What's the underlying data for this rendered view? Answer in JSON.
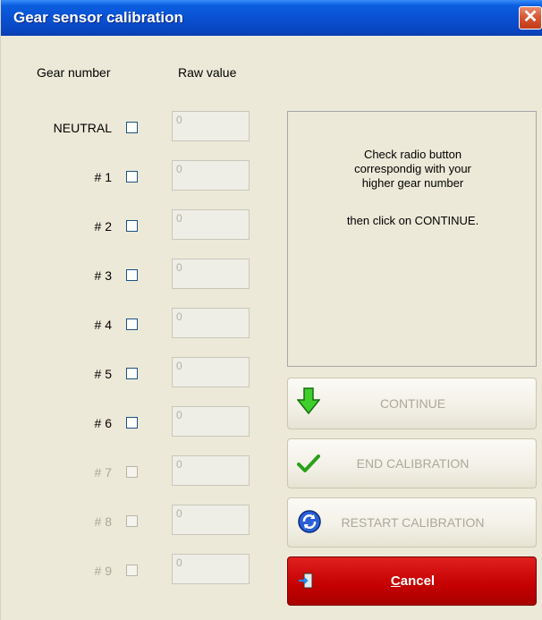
{
  "window": {
    "title": "Gear sensor calibration"
  },
  "headers": {
    "gear_number": "Gear number",
    "raw_value": "Raw value"
  },
  "rows": [
    {
      "label": "NEUTRAL",
      "value": "0",
      "enabled": true
    },
    {
      "label": "# 1",
      "value": "0",
      "enabled": true
    },
    {
      "label": "# 2",
      "value": "0",
      "enabled": true
    },
    {
      "label": "# 3",
      "value": "0",
      "enabled": true
    },
    {
      "label": "# 4",
      "value": "0",
      "enabled": true
    },
    {
      "label": "# 5",
      "value": "0",
      "enabled": true
    },
    {
      "label": "# 6",
      "value": "0",
      "enabled": true
    },
    {
      "label": "# 7",
      "value": "0",
      "enabled": false
    },
    {
      "label": "# 8",
      "value": "0",
      "enabled": false
    },
    {
      "label": "# 9",
      "value": "0",
      "enabled": false
    }
  ],
  "info": {
    "line1": "Check radio button",
    "line2": "correspondig with your",
    "line3": "higher gear number",
    "line4": "then click on CONTINUE."
  },
  "buttons": {
    "continue": {
      "label": "CONTINUE",
      "icon": "green-down-arrow-icon"
    },
    "end": {
      "label": "END CALIBRATION",
      "icon": "green-check-icon"
    },
    "restart": {
      "label": "RESTART CALIBRATION",
      "icon": "refresh-icon"
    },
    "cancel": {
      "label": "Cancel",
      "icon": "exit-door-icon"
    }
  },
  "colors": {
    "titlebar": "#0a4fd0",
    "cancel": "#c40000",
    "disabled_text": "#aca899"
  }
}
